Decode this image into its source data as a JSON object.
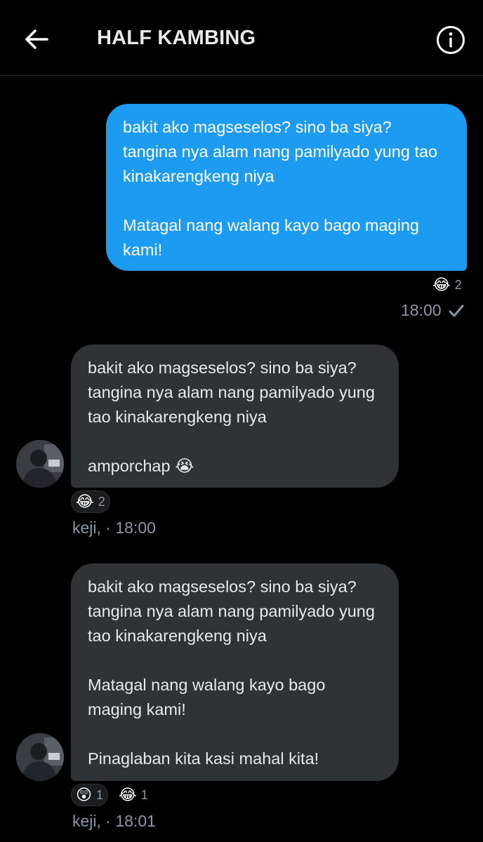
{
  "header": {
    "title": "HALF KAMBING",
    "back_icon": "arrow-left-icon",
    "info_icon": "info-circle-icon"
  },
  "colors": {
    "background": "#000000",
    "outgoing_bubble": "#1d9bf0",
    "incoming_bubble": "#2f3336",
    "muted_text": "#8b98a5"
  },
  "messages": [
    {
      "direction": "outgoing",
      "text": "bakit ako magseselos? sino ba siya? tangina nya alam nang pamilyado yung tao kinakarengkeng niya\n\nMatagal nang walang kayo bago maging kami!",
      "reactions": [
        {
          "emoji": "😂",
          "count": "2"
        }
      ],
      "time": "18:00",
      "status_icon": "check-icon"
    },
    {
      "direction": "incoming",
      "text": "bakit ako magseselos? sino ba siya? tangina nya alam nang pamilyado yung tao kinakarengkeng niya\n\namporchap 😭",
      "reactions": [
        {
          "emoji": "😂",
          "count": "2"
        }
      ],
      "meta": "keji, · 18:00"
    },
    {
      "direction": "incoming",
      "text": "bakit ako magseselos? sino ba siya? tangina nya alam nang pamilyado yung tao kinakarengkeng niya\n\nMatagal nang walang kayo bago maging kami!\n\nPinaglaban kita kasi mahal kita!",
      "reactions": [
        {
          "emoji": "😲",
          "count": "1"
        },
        {
          "emoji": "😂",
          "count": "1"
        }
      ],
      "meta": "keji, · 18:01"
    }
  ]
}
